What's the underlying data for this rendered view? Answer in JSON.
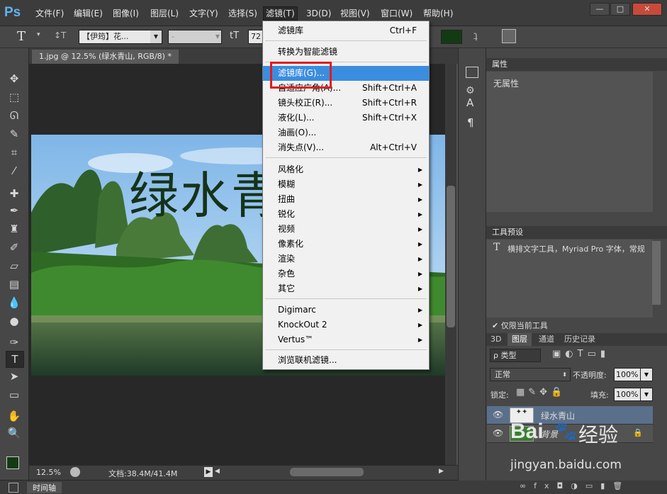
{
  "app": {
    "logo": "Ps"
  },
  "menubar": {
    "items": [
      "文件(F)",
      "编辑(E)",
      "图像(I)",
      "图层(L)",
      "文字(Y)",
      "选择(S)",
      "滤镜(T)",
      "3D(D)",
      "视图(V)",
      "窗口(W)",
      "帮助(H)"
    ],
    "window_buttons": [
      "—",
      "□",
      "✕"
    ]
  },
  "options": {
    "tool_icon": "T",
    "orientation_icon": "↕T",
    "font_family": "【伊筠】花...",
    "font_style": "-",
    "size_icon": "tT",
    "size": "72",
    "color": "#143a14"
  },
  "document": {
    "tab": "1.jpg @ 12.5% (绿水青山, RGB/8) *",
    "overlay_text": "绿水青"
  },
  "status": {
    "zoom": "12.5%",
    "doc_info": "文档:38.4M/41.4M"
  },
  "timeline": {
    "label": "时间轴"
  },
  "properties": {
    "title": "属性",
    "content": "无属性"
  },
  "tool_presets": {
    "title": "工具预设",
    "item": "横排文字工具，Myriad Pro 字体，常规",
    "checkbox_label": "仅限当前工具"
  },
  "layers_panel": {
    "tabs": [
      "3D",
      "图层",
      "通道",
      "历史记录"
    ],
    "filter_label": "ρ 类型",
    "blend_mode": "正常",
    "opacity_label": "不透明度:",
    "opacity": "100%",
    "lock_label": "锁定:",
    "fill_label": "填充:",
    "fill": "100%",
    "layers": [
      {
        "name": "绿水青山"
      },
      {
        "name": "背景"
      }
    ],
    "footer_icons": [
      "∞",
      "fx",
      "◘",
      "◑",
      "▭",
      "▮",
      "🗑"
    ]
  },
  "filter_menu": {
    "items": [
      {
        "label": "滤镜库",
        "shortcut": "Ctrl+F"
      },
      {
        "label": "转换为智能滤镜",
        "shortcut": ""
      },
      {
        "label": "滤镜库(G)...",
        "shortcut": "",
        "highlight": true
      },
      {
        "label": "自适应广角(A)...",
        "shortcut": "Shift+Ctrl+A"
      },
      {
        "label": "镜头校正(R)...",
        "shortcut": "Shift+Ctrl+R"
      },
      {
        "label": "液化(L)...",
        "shortcut": "Shift+Ctrl+X"
      },
      {
        "label": "油画(O)...",
        "shortcut": ""
      },
      {
        "label": "消失点(V)...",
        "shortcut": "Alt+Ctrl+V"
      },
      {
        "label": "风格化",
        "sub": true
      },
      {
        "label": "模糊",
        "sub": true
      },
      {
        "label": "扭曲",
        "sub": true
      },
      {
        "label": "锐化",
        "sub": true
      },
      {
        "label": "视频",
        "sub": true
      },
      {
        "label": "像素化",
        "sub": true
      },
      {
        "label": "渲染",
        "sub": true
      },
      {
        "label": "杂色",
        "sub": true
      },
      {
        "label": "其它",
        "sub": true
      },
      {
        "label": "Digimarc",
        "sub": true
      },
      {
        "label": "KnockOut 2",
        "sub": true
      },
      {
        "label": "Vertus™",
        "sub": true
      },
      {
        "label": "浏览联机滤镜..."
      }
    ]
  },
  "watermark": {
    "brand": "Bai",
    "brand2": "经验",
    "url": "jingyan.baidu.com"
  },
  "colors": {
    "menu_highlight": "#3b8de0",
    "annotation_red": "#e11b1b"
  }
}
